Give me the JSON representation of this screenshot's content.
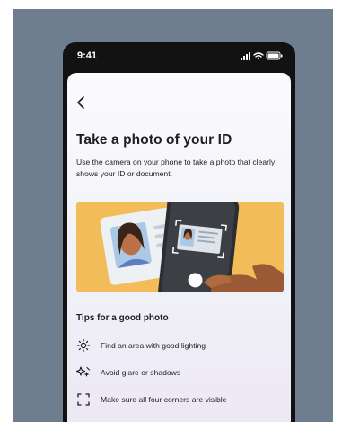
{
  "status_bar": {
    "time": "9:41",
    "icons": [
      "signal-icon",
      "wifi-icon",
      "battery-icon"
    ]
  },
  "screen": {
    "back_icon": "chevron-left-icon",
    "title": "Take a photo of your ID",
    "description": "Use the camera on your phone to take a photo that clearly shows your ID or document.",
    "illustration": "phone-scanning-id-card-illustration",
    "tips_heading": "Tips for a good photo",
    "tips": [
      {
        "icon": "sun-icon",
        "label": "Find an area with good lighting"
      },
      {
        "icon": "sparkle-icon",
        "label": "Avoid glare or shadows"
      },
      {
        "icon": "frame-corners-icon",
        "label": "Make sure all four corners are visible"
      }
    ]
  },
  "colors": {
    "backdrop": "#6f7e8e",
    "phone_frame": "#121212",
    "text": "#1c1e21",
    "illustration_bg": "#f2bd58"
  }
}
